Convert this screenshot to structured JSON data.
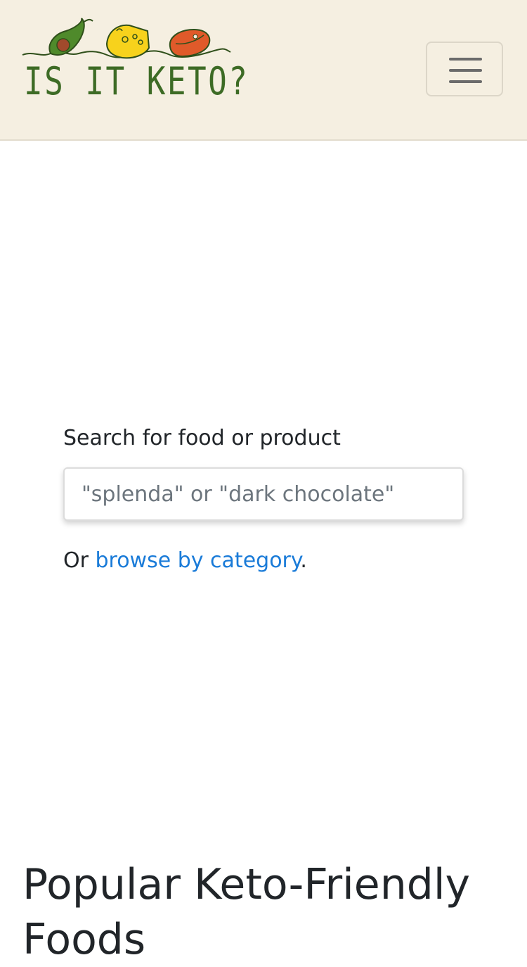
{
  "header": {
    "logo_text": "IS IT KETO?",
    "menu_icon": "hamburger-icon",
    "background_color": "#f5efe1",
    "logo_color": "#3d6b25"
  },
  "search": {
    "label": "Search for food or product",
    "placeholder": "\"splenda\" or \"dark chocolate\"",
    "value": ""
  },
  "browse": {
    "prefix": "Or ",
    "link_label": "browse by category",
    "suffix": ".",
    "link_color": "#1a7bd8"
  },
  "popular": {
    "heading": "Popular Keto-Friendly Foods"
  }
}
